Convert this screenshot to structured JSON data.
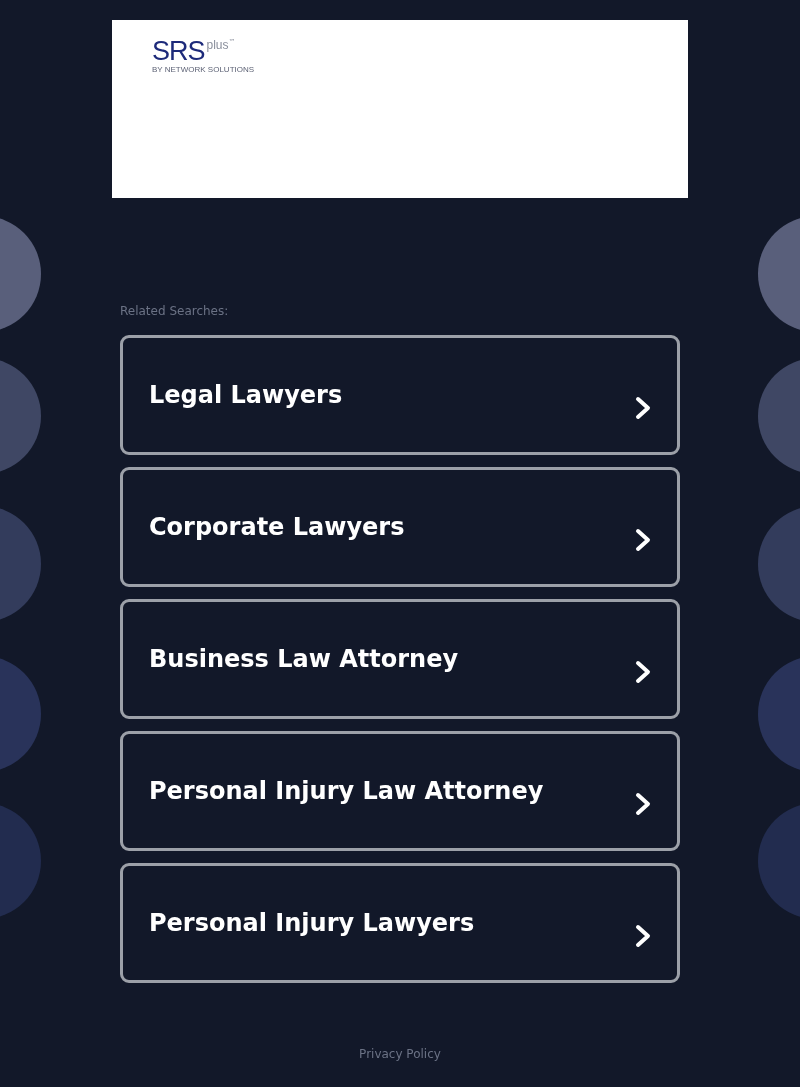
{
  "logo": {
    "brand": "SRS",
    "suffix": "plus",
    "mark": "™",
    "tagline": "BY NETWORK SOLUTIONS"
  },
  "related_searches": {
    "label": "Related Searches:",
    "items": [
      {
        "title": "Legal Lawyers"
      },
      {
        "title": "Corporate Lawyers"
      },
      {
        "title": "Business Law Attorney"
      },
      {
        "title": "Personal Injury Law Attorney"
      },
      {
        "title": "Personal Injury Lawyers"
      }
    ]
  },
  "footer": {
    "link": "Privacy Policy"
  }
}
